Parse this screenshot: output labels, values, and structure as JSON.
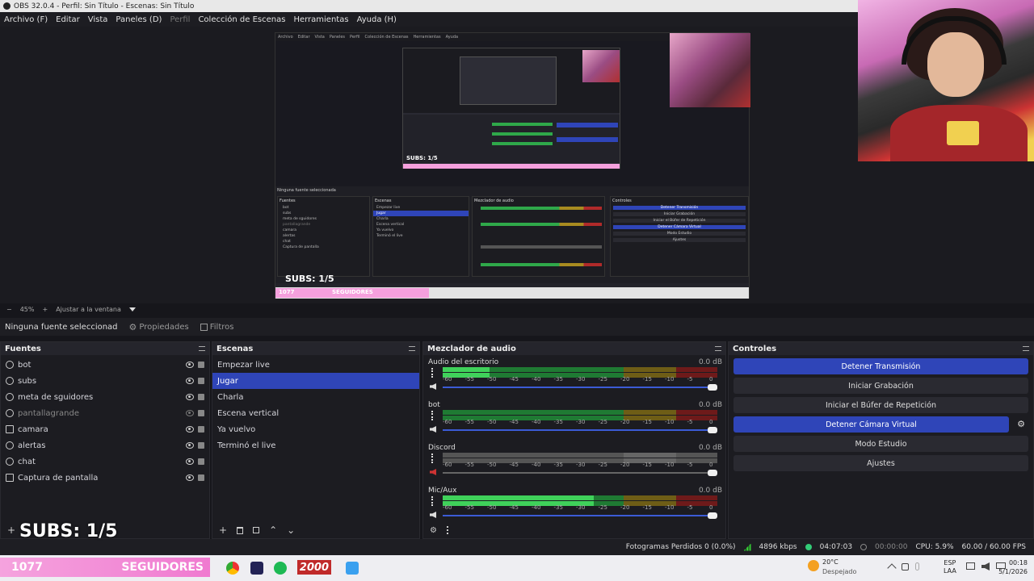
{
  "titlebar": {
    "title": "OBS 32.0.4 - Perfil: Sin Título - Escenas: Sin Título"
  },
  "menu": [
    "Archivo (F)",
    "Editar",
    "Vista",
    "Paneles (D)",
    "Perfil",
    "Colección de Escenas",
    "Herramientas",
    "Ayuda (H)"
  ],
  "zoom": {
    "minus": "−",
    "value": "45%",
    "plus": "+",
    "fit": "Ajustar a la ventana"
  },
  "properties_bar": {
    "no_source": "Ninguna fuente seleccionad",
    "properties": "Propiedades",
    "filters": "Filtros"
  },
  "sources": {
    "title": "Fuentes",
    "items": [
      {
        "name": "bot",
        "icon": "globe-icon",
        "visible": true
      },
      {
        "name": "subs",
        "icon": "globe-icon",
        "visible": true
      },
      {
        "name": "meta de sguidores",
        "icon": "globe-icon",
        "visible": true
      },
      {
        "name": "pantallagrande",
        "icon": "globe-icon",
        "visible": false
      },
      {
        "name": "camara",
        "icon": "camera-icon",
        "visible": true
      },
      {
        "name": "alertas",
        "icon": "globe-icon",
        "visible": true
      },
      {
        "name": "chat",
        "icon": "globe-icon",
        "visible": true
      },
      {
        "name": "Captura de pantalla",
        "icon": "monitor-icon",
        "visible": true
      }
    ]
  },
  "scenes": {
    "title": "Escenas",
    "items": [
      "Empezar live",
      "Jugar",
      "Charla",
      "Escena vertical",
      "Ya vuelvo",
      "Terminó el live"
    ],
    "selected": "Jugar"
  },
  "mixer": {
    "title": "Mezclador de audio",
    "channels": [
      {
        "name": "Audio del escritorio",
        "db": "0.0 dB",
        "level": 0.17,
        "muted": false
      },
      {
        "name": "bot",
        "db": "0.0 dB",
        "level": 0.0,
        "muted": false
      },
      {
        "name": "Discord",
        "db": "0.0 dB",
        "level": 0.0,
        "muted": true
      },
      {
        "name": "Mic/Aux",
        "db": "0.0 dB",
        "level": 0.55,
        "muted": false
      }
    ],
    "ticks": [
      "-60",
      "-55",
      "-50",
      "-45",
      "-40",
      "-35",
      "-30",
      "-25",
      "-20",
      "-15",
      "-10",
      "-5",
      "0"
    ]
  },
  "controls": {
    "title": "Controles",
    "buttons": [
      {
        "label": "Detener Transmisión",
        "active": true
      },
      {
        "label": "Iniciar Grabación",
        "active": false
      },
      {
        "label": "Iniciar el Búfer de Repetición",
        "active": false
      },
      {
        "label": "Detener Cámara Virtual",
        "active": true
      },
      {
        "label": "Modo Estudio",
        "active": false
      },
      {
        "label": "Ajustes",
        "active": false
      }
    ]
  },
  "status": {
    "dropped": "Fotogramas Perdidos 0 (0.0%)",
    "bitrate": "4896 kbps",
    "stream_time": "04:07:03",
    "rec_time": "00:00:00",
    "cpu": "CPU: 5.9%",
    "fps": "60.00 / 60.00 FPS"
  },
  "overlay": {
    "subs": "SUBS: 1/5",
    "followers_count": "1077",
    "followers_label": "SEGUIDORES",
    "goal": "2000"
  },
  "taskbar": {
    "weather_temp": "20°C",
    "weather_desc": "Despejado",
    "lang": "ESP",
    "lang2": "LAA",
    "time": "00:18",
    "date": "5/1/2026"
  },
  "nested_preview": {
    "subs": "SUBS: 1/5",
    "followers": "1077",
    "followers_label": "SEGUIDORES"
  }
}
